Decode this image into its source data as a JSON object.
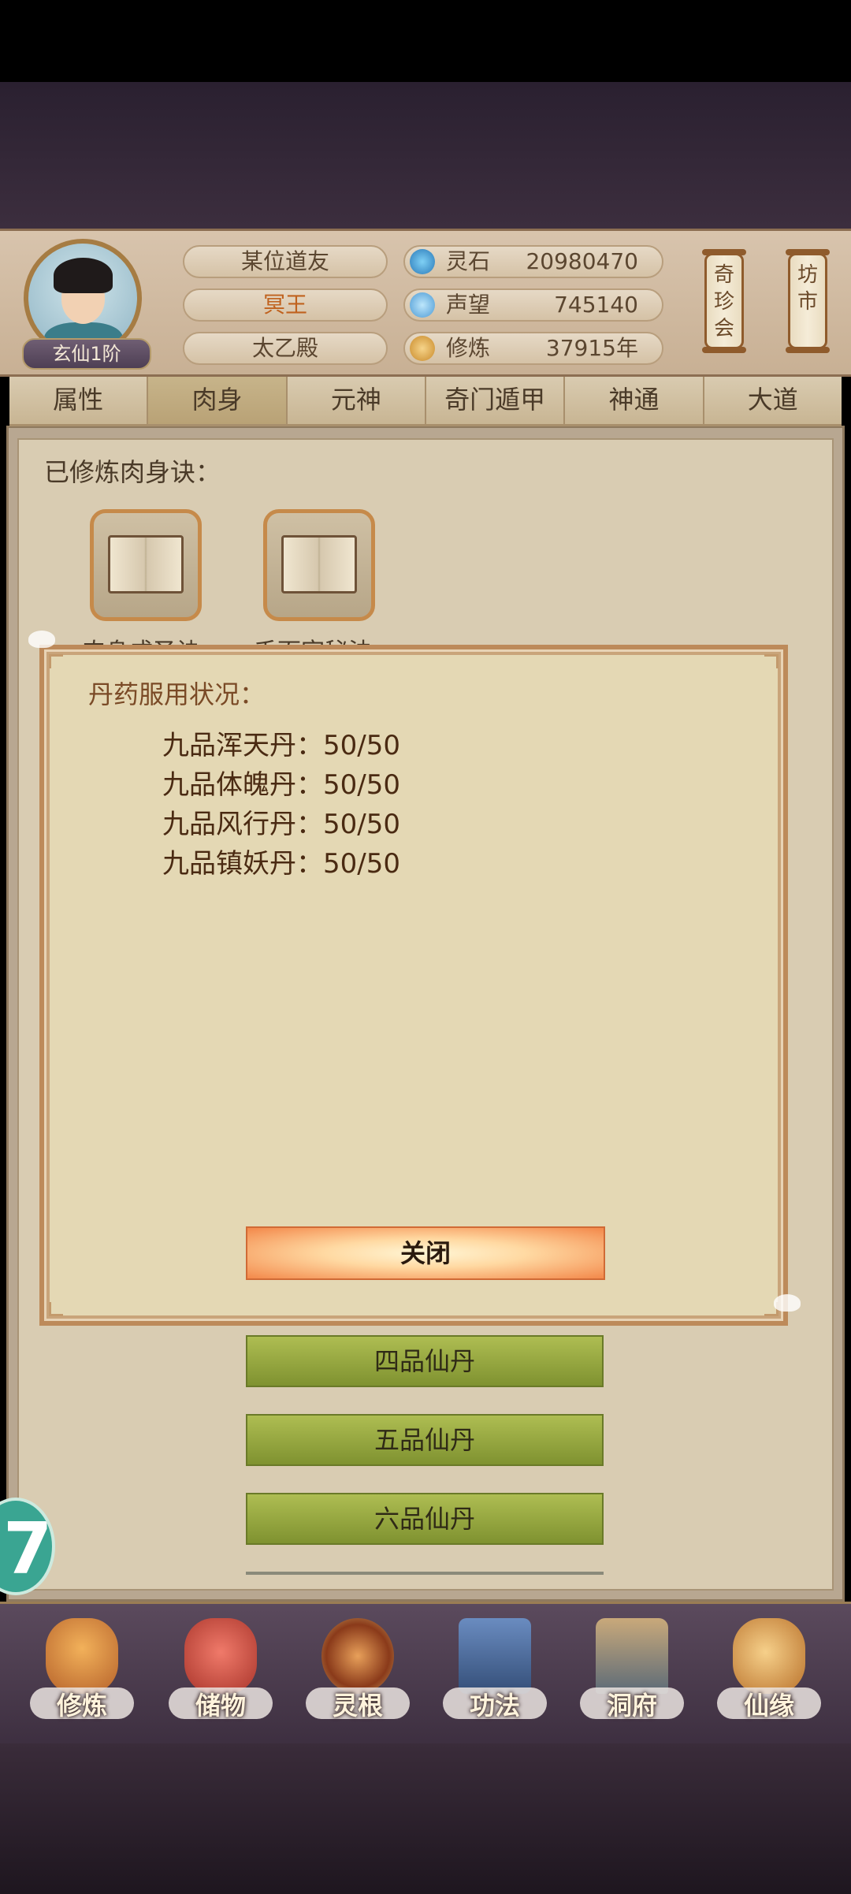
{
  "header": {
    "realm_rank": "玄仙1阶",
    "player_name": "某位道友",
    "title": "冥王",
    "sect": "太乙殿",
    "resources": [
      {
        "label": "灵石",
        "value": "20980470",
        "icon": "spirit-stone-icon",
        "color": "#3a8fc9"
      },
      {
        "label": "声望",
        "value": "745140",
        "icon": "reputation-icon",
        "color": "#5aa6d8"
      },
      {
        "label": "修炼",
        "value": "37915年",
        "icon": "meditation-icon",
        "color": "#d7a24a"
      }
    ],
    "scroll_buttons": [
      {
        "label": "奇珍会"
      },
      {
        "label": "坊市"
      }
    ]
  },
  "tabs": [
    {
      "label": "属性"
    },
    {
      "label": "肉身"
    },
    {
      "label": "元神"
    },
    {
      "label": "奇门遁甲"
    },
    {
      "label": "神通"
    },
    {
      "label": "大道"
    }
  ],
  "active_tab": "肉身",
  "main": {
    "section_title": "已修炼肉身诀：",
    "books": [
      {
        "label": "肉身成圣诀"
      },
      {
        "label": "千面宗秘法"
      }
    ],
    "pill_buttons": [
      {
        "label": "四品仙丹"
      },
      {
        "label": "五品仙丹"
      },
      {
        "label": "六品仙丹"
      }
    ],
    "float_badge": "7"
  },
  "dialog": {
    "title": "丹药服用状况：",
    "rows": [
      {
        "name": "九品浑天丹：",
        "value": "50/50"
      },
      {
        "name": "九品体魄丹：",
        "value": "50/50"
      },
      {
        "name": "九品风行丹：",
        "value": "50/50"
      },
      {
        "name": "九品镇妖丹：",
        "value": "50/50"
      }
    ],
    "close_label": "关闭"
  },
  "navbar": [
    {
      "label": "修炼",
      "icon": "cultivate-icon",
      "color": "#d58a3a"
    },
    {
      "label": "储物",
      "icon": "storage-bag-icon",
      "color": "#c8453a"
    },
    {
      "label": "灵根",
      "icon": "spirit-root-icon",
      "color": "#a8542a"
    },
    {
      "label": "功法",
      "icon": "technique-book-icon",
      "color": "#4a6fa0"
    },
    {
      "label": "洞府",
      "icon": "cave-dwelling-icon",
      "color": "#7a8a9a"
    },
    {
      "label": "仙缘",
      "icon": "immortal-fate-icon",
      "color": "#d9a24a"
    }
  ]
}
